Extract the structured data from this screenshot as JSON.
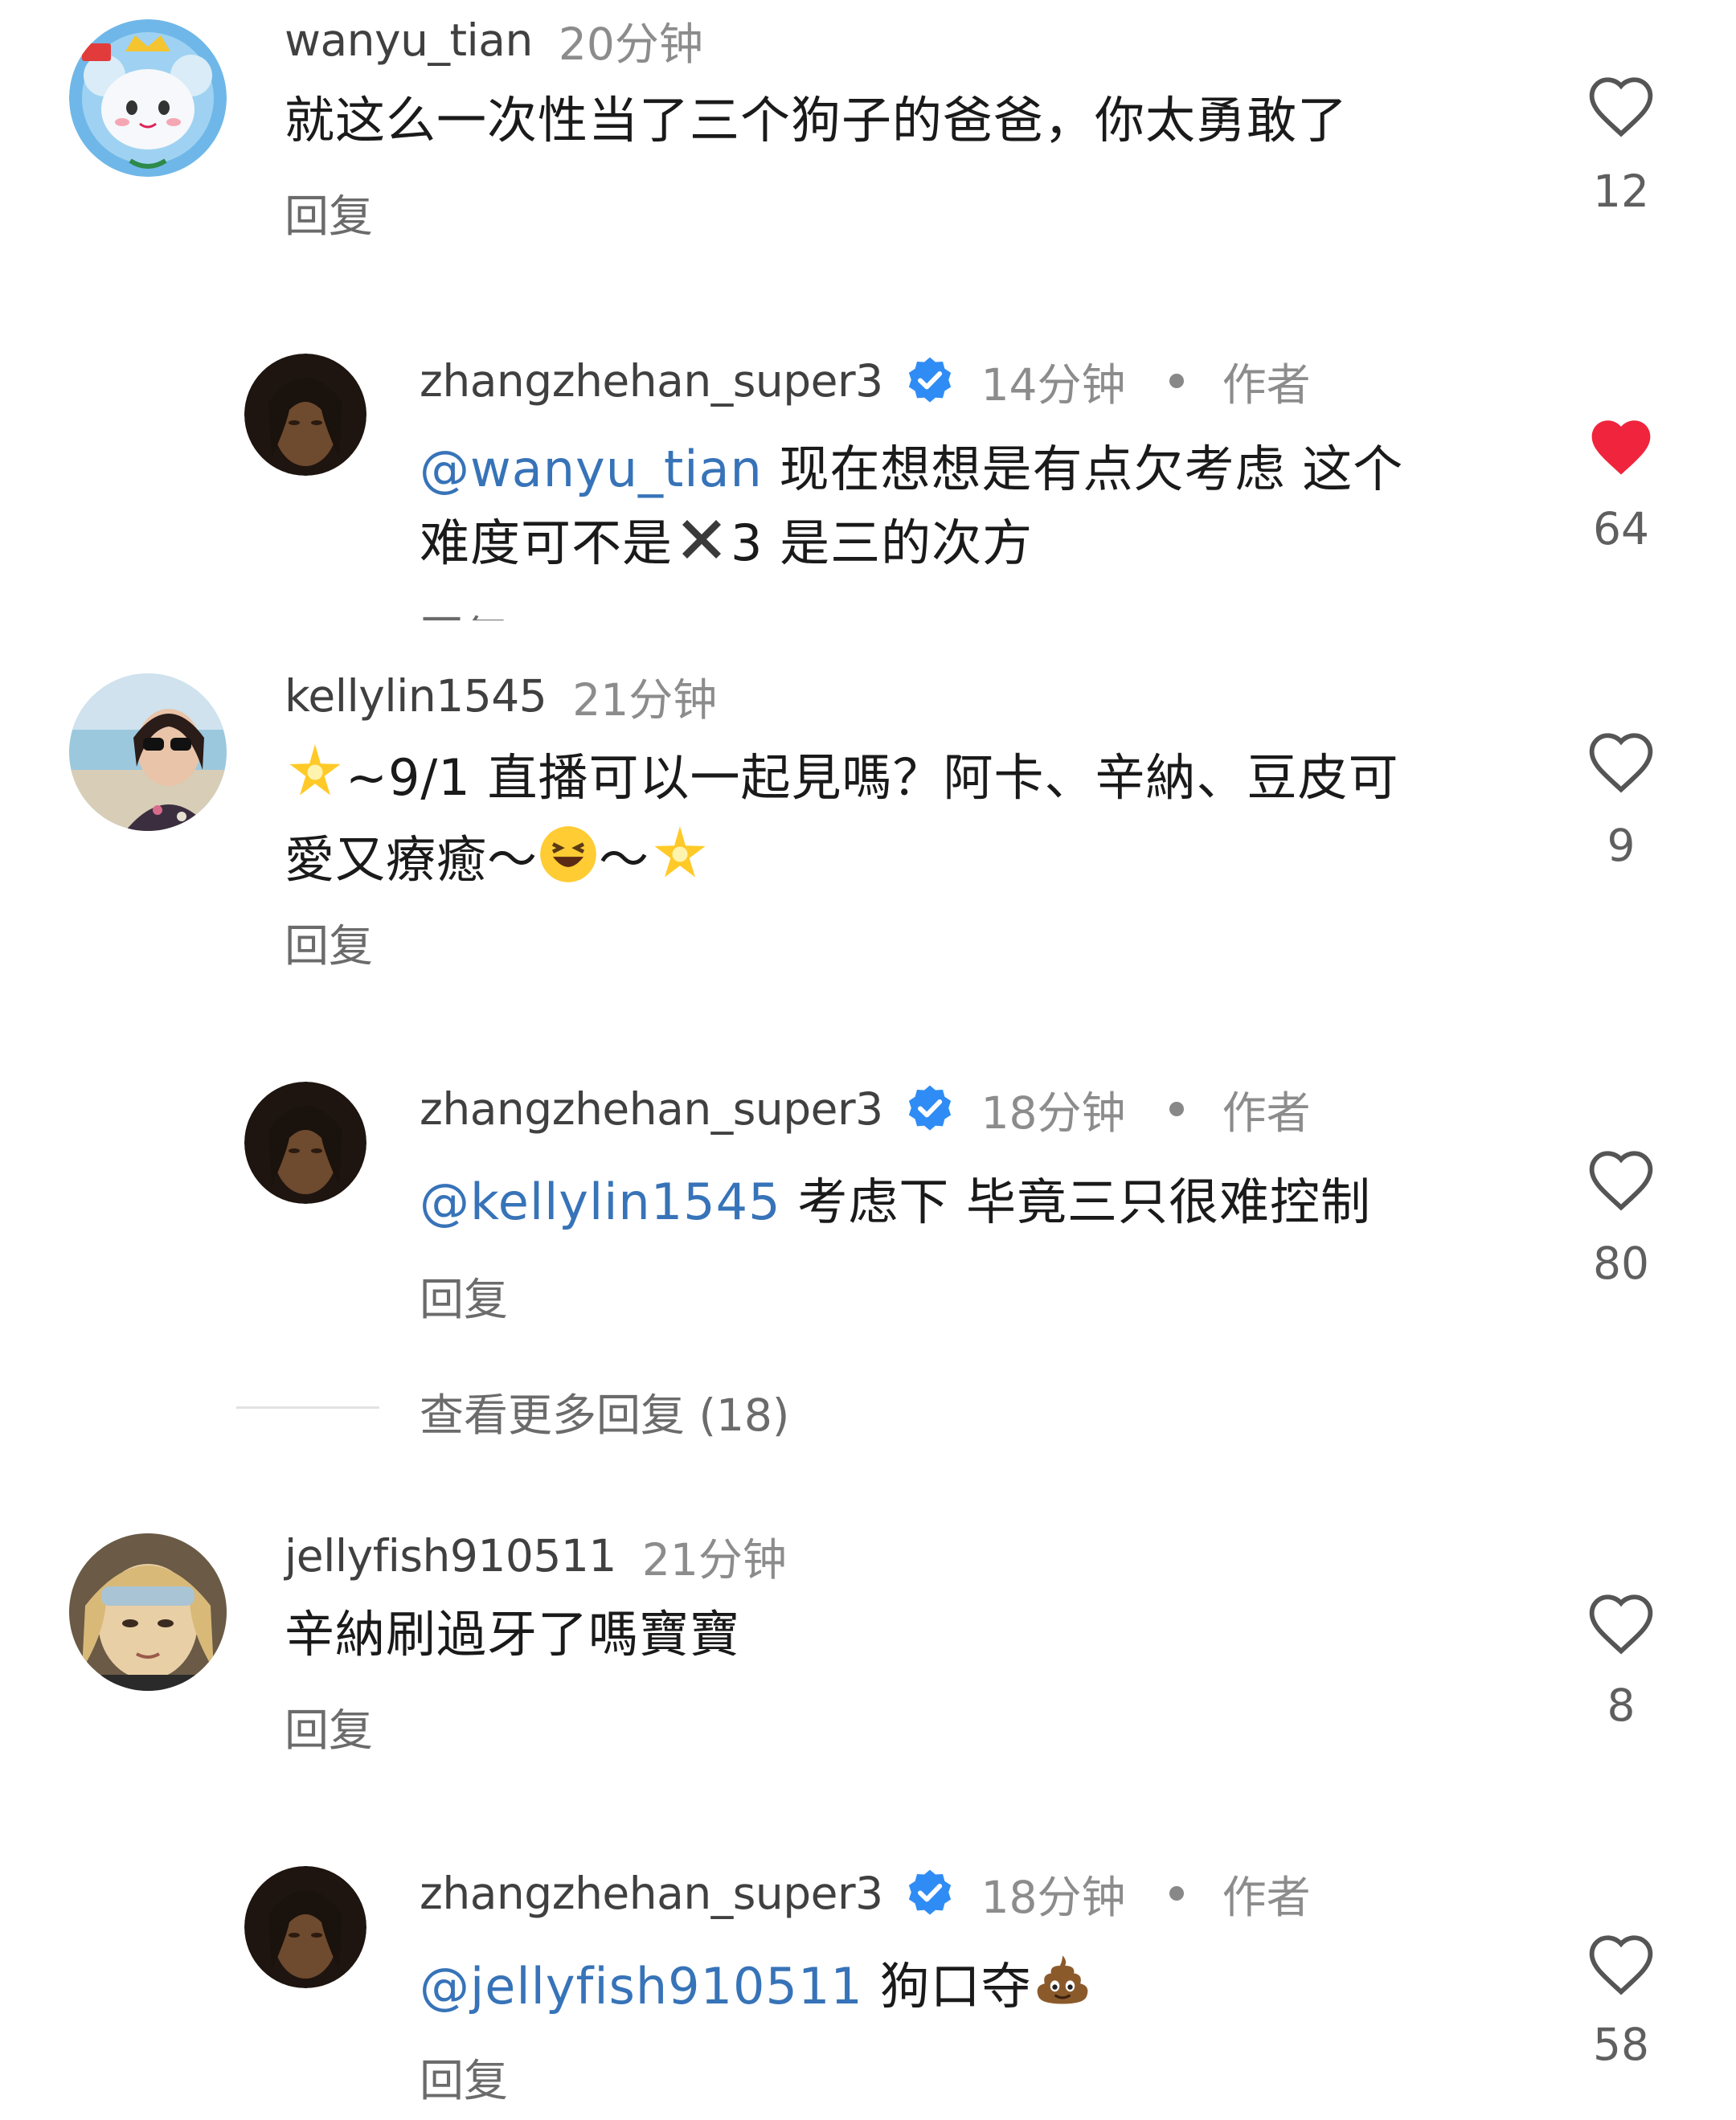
{
  "comments": [
    {
      "username": "wanyu_tian",
      "time": "20分钟",
      "text": "就这么一次性当了三个狗子的爸爸，你太勇敢了",
      "reply": "回复",
      "likes": "12",
      "liked": false
    },
    {
      "username": "zhangzhehan_super3",
      "time": "14分钟",
      "author": "作者",
      "mention": "@wanyu_tian",
      "text_line1": "现在想想是有点欠考虑 这个",
      "text_line2_a": "难度可不是",
      "text_line2_b": "3 是三的次方",
      "reply": "回复",
      "likes": "64",
      "liked": true
    },
    {
      "username": "kellylin1545",
      "time": "21分钟",
      "text_line1": "~9/1 直播可以一起見嗎？阿卡、辛納、豆皮可",
      "text_line2": "愛又療癒～",
      "text_line2_b": "～",
      "reply": "回复",
      "likes": "9",
      "liked": false
    },
    {
      "username": "zhangzhehan_super3",
      "time": "18分钟",
      "author": "作者",
      "mention": "@kellylin1545",
      "text": "考虑下 毕竟三只很难控制",
      "reply": "回复",
      "likes": "80",
      "liked": false
    },
    {
      "username": "jellyfish910511",
      "time": "21分钟",
      "text": "辛納刷過牙了嗎寶寶",
      "reply": "回复",
      "likes": "8",
      "liked": false
    },
    {
      "username": "zhangzhehan_super3",
      "time": "18分钟",
      "author": "作者",
      "mention": "@jellyfish910511",
      "text": "狗口夺",
      "reply": "回复",
      "likes": "58",
      "liked": false
    }
  ],
  "view_more": "查看更多回复 (18)",
  "colors": {
    "accent": "#3773b8",
    "like_active": "#f0243c",
    "verified": "#2f8cf5"
  }
}
